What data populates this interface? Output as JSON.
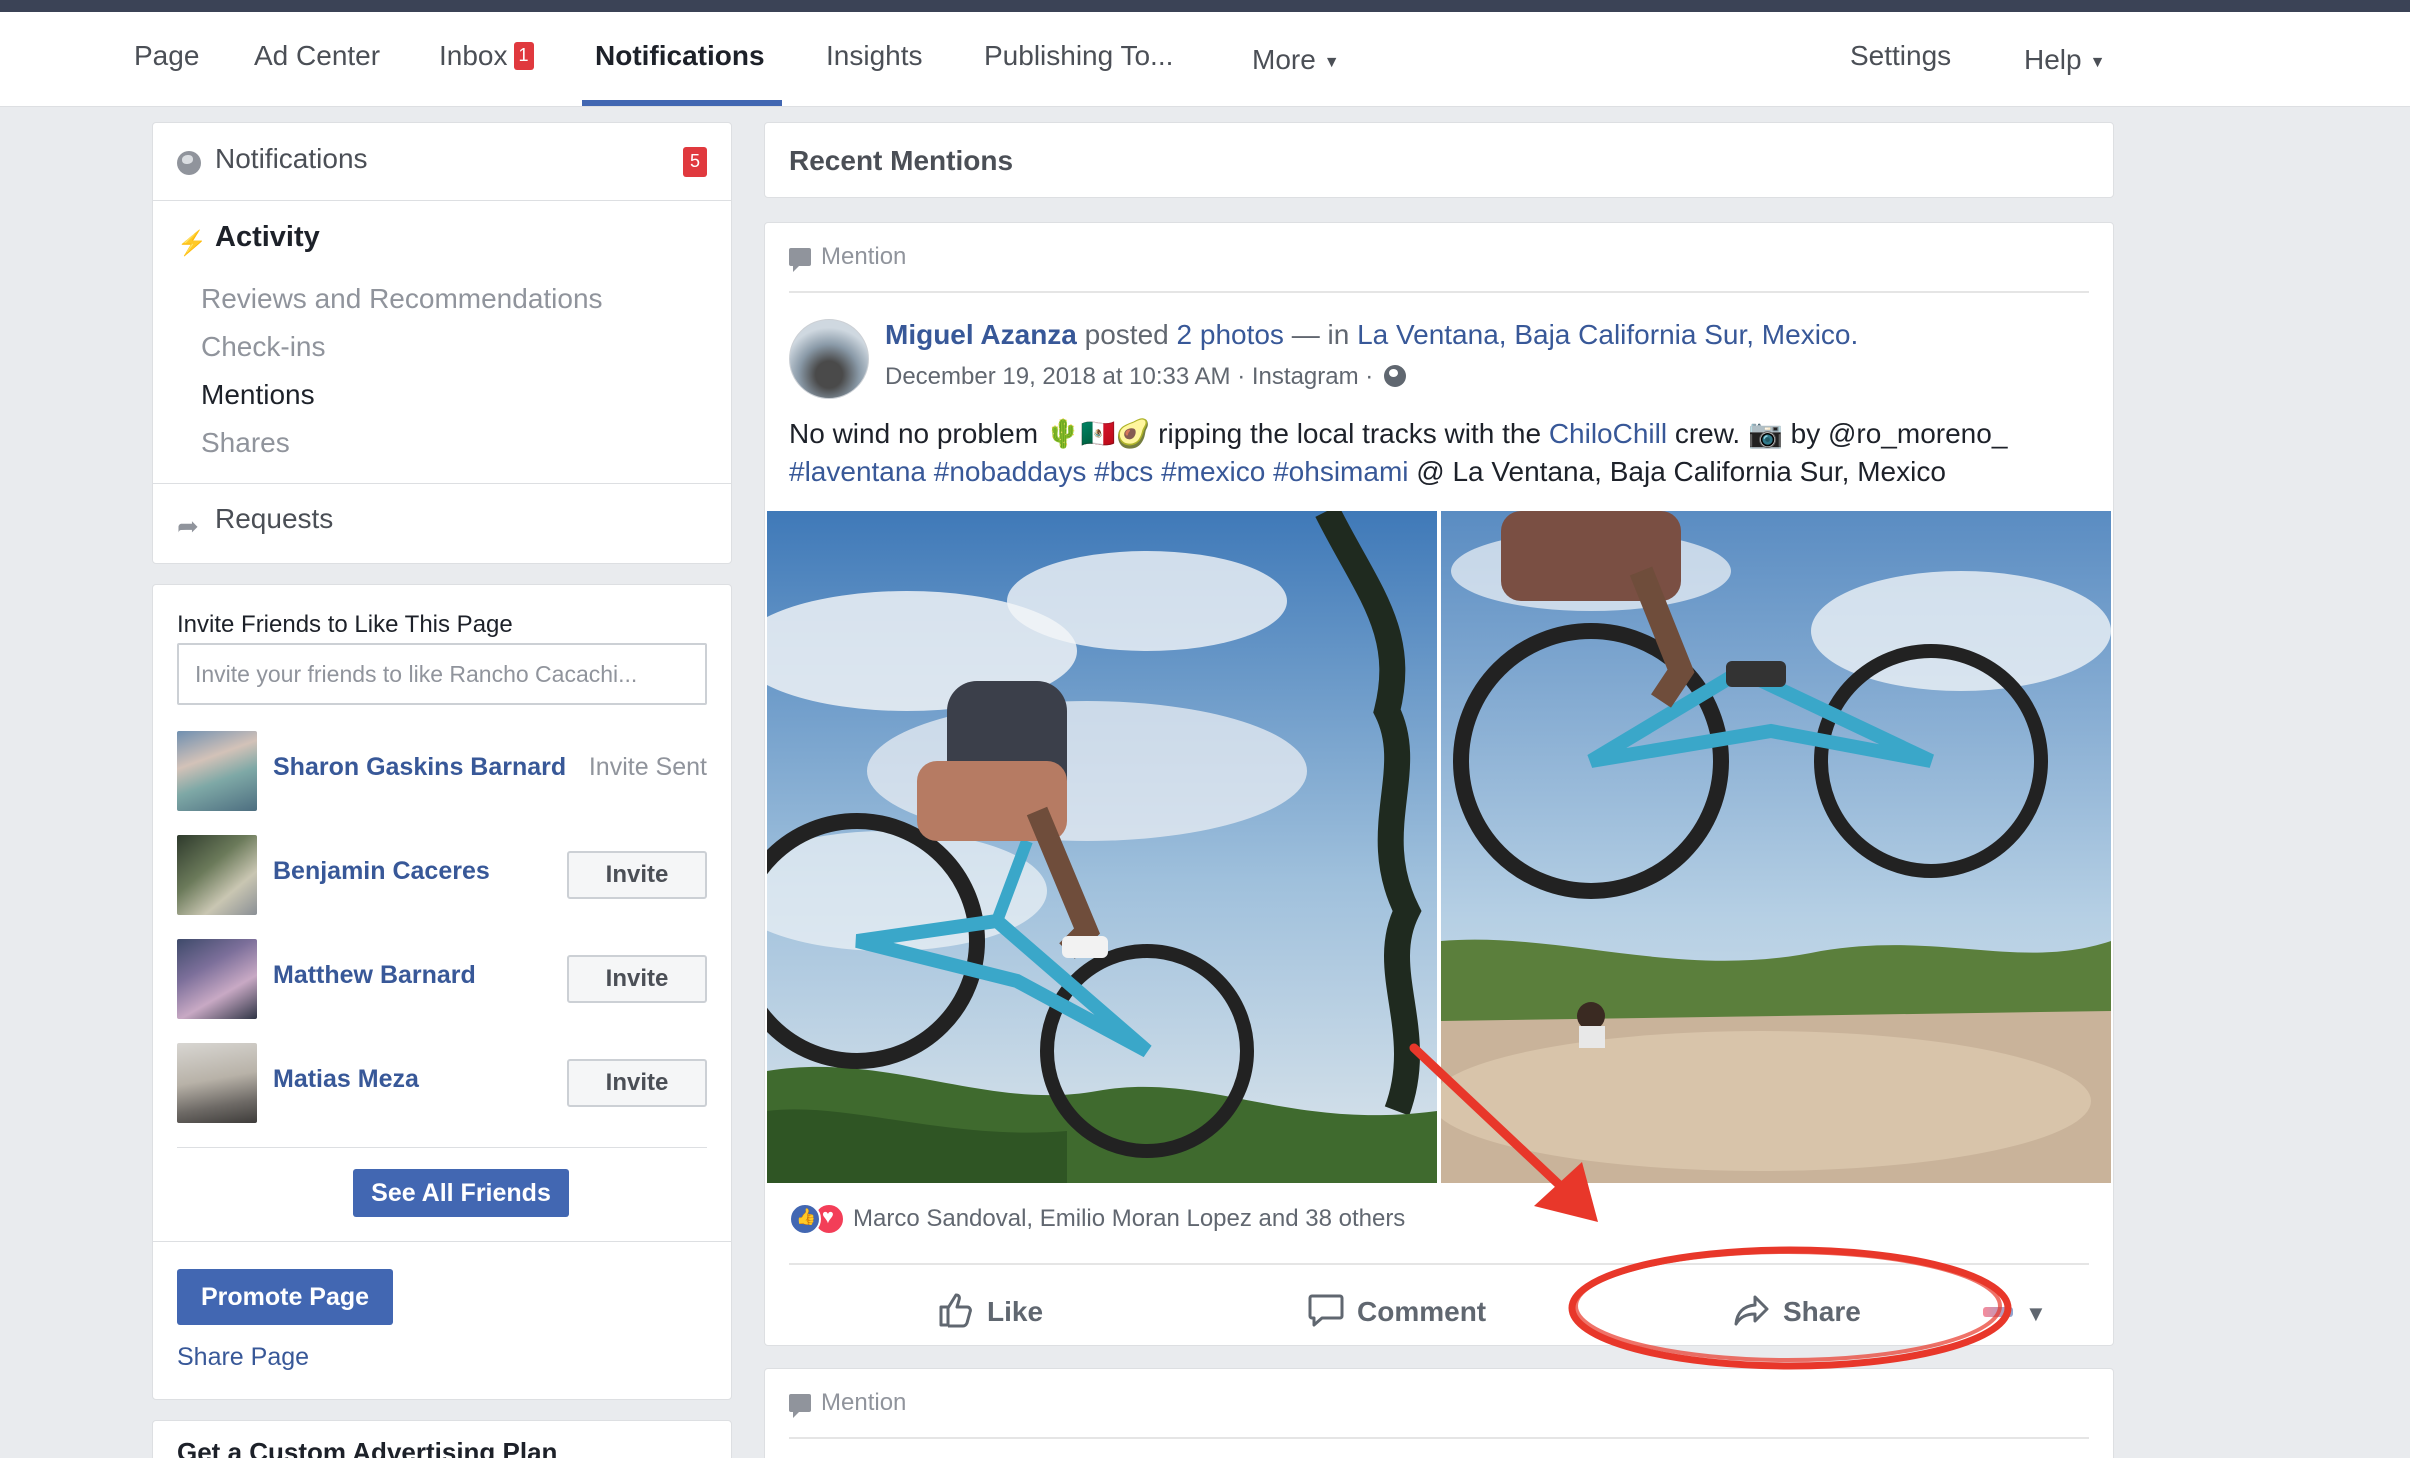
{
  "nav": {
    "items": [
      {
        "label": "Page"
      },
      {
        "label": "Ad Center"
      },
      {
        "label": "Inbox",
        "badge": "1"
      },
      {
        "label": "Notifications",
        "active": true
      },
      {
        "label": "Insights"
      },
      {
        "label": "Publishing To..."
      },
      {
        "label": "More"
      },
      {
        "label": "Settings"
      },
      {
        "label": "Help"
      }
    ]
  },
  "sidebar": {
    "notifications_title": "Notifications",
    "notifications_badge": "5",
    "activity_title": "Activity",
    "activity_items": [
      "Reviews and Recommendations",
      "Check-ins",
      "Mentions",
      "Shares"
    ],
    "selected_item": "Mentions",
    "requests_label": "Requests"
  },
  "invite": {
    "title": "Invite Friends to Like This Page",
    "placeholder": "Invite your friends to like Rancho Cacachi...",
    "friends": [
      {
        "name": "Sharon Gaskins Barnard",
        "status": "Invite Sent"
      },
      {
        "name": "Benjamin Caceres",
        "action": "Invite"
      },
      {
        "name": "Matthew Barnard",
        "action": "Invite"
      },
      {
        "name": "Matias Meza",
        "action": "Invite"
      }
    ],
    "see_all": "See All Friends",
    "promote": "Promote Page",
    "share_page": "Share Page",
    "next_card_title": "Get a Custom Advertising Plan"
  },
  "main": {
    "section_title": "Recent Mentions",
    "post": {
      "type_label": "Mention",
      "author": "Miguel Azanza",
      "verb": "posted",
      "photos_link": "2 photos",
      "separator": "— in",
      "location": "La Ventana, Baja California Sur, Mexico.",
      "meta": "December 19, 2018 at 10:33 AM · Instagram ·",
      "text_part1": "No wind no problem 🌵🇲🇽🥑 ripping the local tracks with the",
      "text_link": "ChiloChill",
      "text_part2": "crew. 📷 by @ro_moreno_",
      "hashtags": "#laventana #nobaddays #bcs #mexico #ohsimami",
      "text_part3": "@ La Ventana, Baja California Sur, Mexico",
      "reactions_text": "Marco Sandoval, Emilio Moran Lopez and 38 others",
      "actions": {
        "like": "Like",
        "comment": "Comment",
        "share": "Share"
      }
    },
    "second_post_type_label": "Mention"
  },
  "colors": {
    "brand": "#4267b2",
    "link": "#385898",
    "badge": "#e0393e",
    "annotation": "#e8372a"
  },
  "icons": [
    "globe-icon",
    "bolt-icon",
    "share-arrow-icon",
    "speech-bubble-icon",
    "thumbs-up-icon",
    "comment-icon",
    "like-reaction-icon",
    "love-reaction-icon",
    "public-globe-icon",
    "caret-down-icon"
  ]
}
